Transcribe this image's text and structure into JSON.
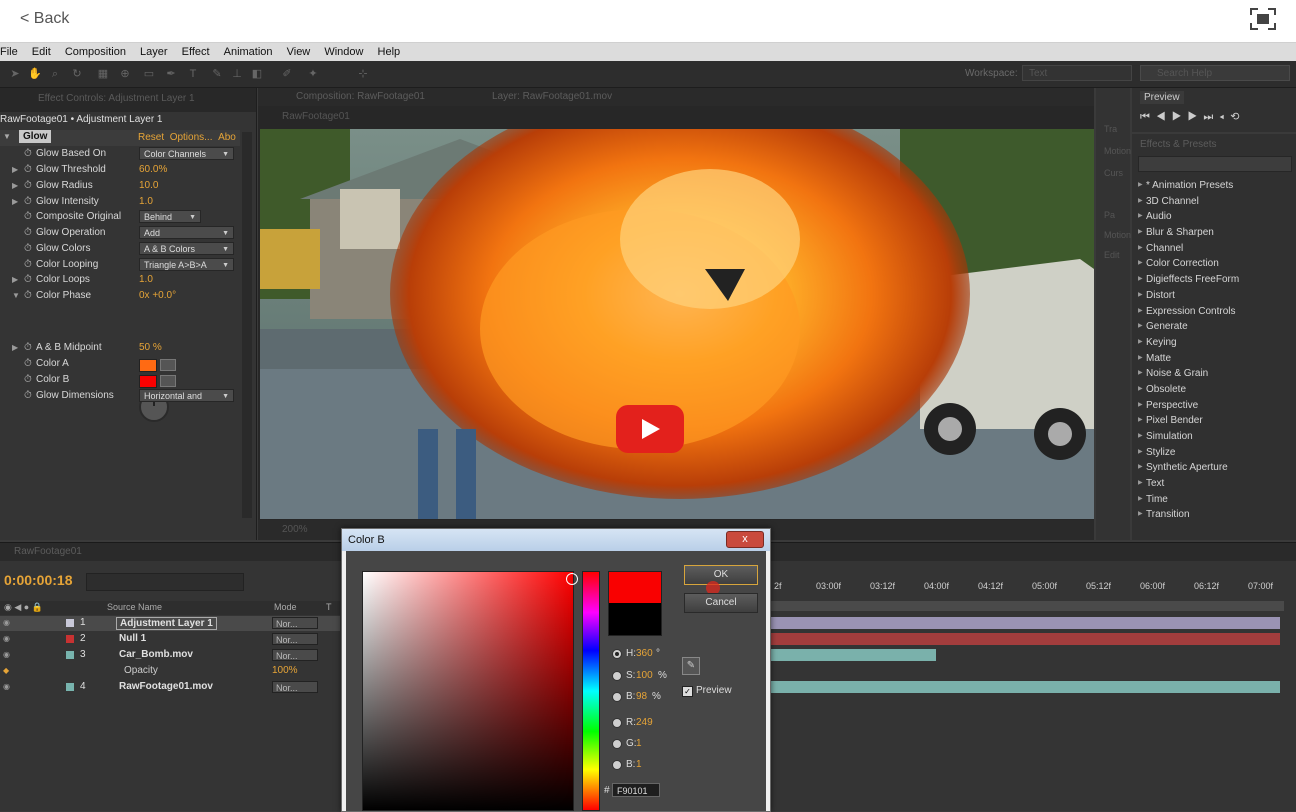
{
  "top_bar": {
    "back_label": "< Back"
  },
  "menu": [
    "File",
    "Edit",
    "Composition",
    "Layer",
    "Effect",
    "Animation",
    "View",
    "Window",
    "Help"
  ],
  "toolbar": {
    "workspace_label": "Workspace:",
    "workspace_value": "Text",
    "search_help": "Search Help"
  },
  "effect_controls": {
    "tab": "Effect Controls: Adjustment Layer 1",
    "title": "RawFootage01 • Adjustment Layer 1",
    "effect_name": "Glow",
    "reset": "Reset",
    "options": "Options...",
    "about": "Abo",
    "props": [
      {
        "label": "Glow Based On",
        "dropdown": "Color Channels"
      },
      {
        "label": "Glow Threshold",
        "value": "60.0%"
      },
      {
        "label": "Glow Radius",
        "value": "10.0"
      },
      {
        "label": "Glow Intensity",
        "value": "1.0"
      },
      {
        "label": "Composite Original",
        "dropdown": "Behind"
      },
      {
        "label": "Glow Operation",
        "dropdown": "Add"
      },
      {
        "label": "Glow Colors",
        "dropdown": "A & B Colors"
      },
      {
        "label": "Color Looping",
        "dropdown": "Triangle A>B>A"
      },
      {
        "label": "Color Loops",
        "value": "1.0"
      },
      {
        "label": "Color Phase",
        "value": "0x +0.0°"
      },
      {
        "label": "A & B Midpoint",
        "value": "50 %"
      },
      {
        "label": "Color A",
        "color": "#ff6a13"
      },
      {
        "label": "Color B",
        "color": "#f90101"
      },
      {
        "label": "Glow Dimensions",
        "dropdown": "Horizontal and"
      }
    ]
  },
  "composition": {
    "tab": "Composition: RawFootage01",
    "layer_tab": "Layer: RawFootage01.mov",
    "sub_tab": "RawFootage01",
    "zoom": "200%"
  },
  "side_panel": {
    "labels": [
      "Tra",
      "Motion",
      "Curs",
      "Pa",
      "Motion",
      "Edit"
    ]
  },
  "preview_panel": {
    "tab": "Preview"
  },
  "effects_presets": {
    "tab": "Effects & Presets",
    "items": [
      "* Animation Presets",
      "3D Channel",
      "Audio",
      "Blur & Sharpen",
      "Channel",
      "Color Correction",
      "Digieffects FreeForm",
      "Distort",
      "Expression Controls",
      "Generate",
      "Keying",
      "Matte",
      "Noise & Grain",
      "Obsolete",
      "Perspective",
      "Pixel Bender",
      "Simulation",
      "Stylize",
      "Synthetic Aperture",
      "Text",
      "Time",
      "Transition"
    ]
  },
  "timeline": {
    "tab": "RawFootage01",
    "timecode": "0:00:00:18",
    "col_source": "Source Name",
    "col_mode": "Mode",
    "col_t": "T",
    "layers": [
      {
        "num": "1",
        "name": "Adjustment Layer 1",
        "mode": "Nor...",
        "label_color": "#c8c8d8",
        "bar_color": "#9a93b4"
      },
      {
        "num": "2",
        "name": "Null 1",
        "mode": "Nor...",
        "label_color": "#c83232",
        "bar_color": "#a33d3d"
      },
      {
        "num": "3",
        "name": "Car_Bomb.mov",
        "mode": "Nor...",
        "label_color": "#78b4ae",
        "bar_color": "#7ab1ab"
      },
      {
        "num": "4",
        "name": "RawFootage01.mov",
        "mode": "Nor...",
        "label_color": "#78b4ae",
        "bar_color": "#7ab1ab"
      }
    ],
    "opacity_label": "Opacity",
    "opacity_value": "100%",
    "ruler": [
      "2f",
      "03:00f",
      "03:12f",
      "04:00f",
      "04:12f",
      "05:00f",
      "05:12f",
      "06:00f",
      "06:12f",
      "07:00f"
    ]
  },
  "color_dialog": {
    "title": "Color B",
    "close": "x",
    "ok": "OK",
    "cancel": "Cancel",
    "new_color": "#f90101",
    "current_color": "#000000",
    "h_label": "H:",
    "h_value": "360",
    "h_unit": "°",
    "s_label": "S:",
    "s_value": "100",
    "s_unit": "%",
    "b_label": "B:",
    "b_value": "98",
    "b_unit": "%",
    "r_label": "R:",
    "r_value": "249",
    "g_label": "G:",
    "g_value": "1",
    "blue_label": "B:",
    "blue_value": "1",
    "hex_value": "F90101",
    "preview_label": "Preview"
  }
}
